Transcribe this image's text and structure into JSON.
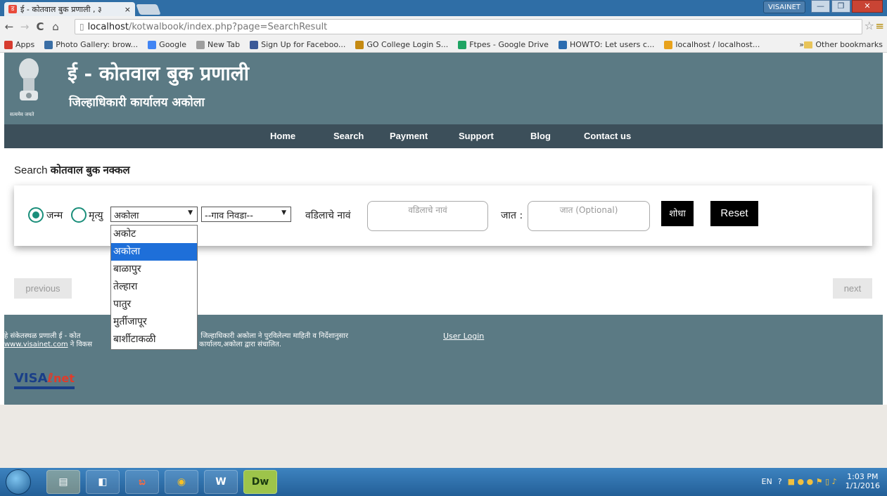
{
  "browser": {
    "tab_title": "ई - कोतवाल बुक प्रणाली , ३",
    "tab_close": "×",
    "url_host": "localhost",
    "url_path": "/kotwalbook/index.php?page=SearchResult",
    "account": "VISAINET",
    "win_min": "—",
    "win_max": "❐",
    "win_close": "✕"
  },
  "bookmarks": [
    {
      "label": "Apps",
      "color": "#d63b2f"
    },
    {
      "label": "Photo Gallery: brow...",
      "color": "#3a6ea5"
    },
    {
      "label": "Google",
      "color": "#4285f4"
    },
    {
      "label": "New Tab",
      "color": "#9e9e9e"
    },
    {
      "label": "Sign Up for Faceboo...",
      "color": "#3b5998"
    },
    {
      "label": "GO College Login S...",
      "color": "#c58a12"
    },
    {
      "label": "Ftpes - Google Drive",
      "color": "#1fa463"
    },
    {
      "label": "HOWTO: Let users c...",
      "color": "#2b6cb0"
    },
    {
      "label": "localhost / localhost...",
      "color": "#e8a21c"
    }
  ],
  "bookmarks_more": "»",
  "bookmarks_other": "Other bookmarks",
  "header": {
    "emblem_caption": "सत्यमेव जयते",
    "title": "ई - कोतवाल बुक प्रणाली",
    "subtitle": "जिल्हाधिकारी कार्यालय अकोला"
  },
  "nav": [
    "Home",
    "Search",
    "Payment",
    "Support",
    "Blog",
    "Contact us"
  ],
  "page_heading_prefix": "Search",
  "page_heading_main": "कोतवाल बुक नक्कल",
  "search": {
    "radio_birth": "जन्म",
    "radio_death": "मृत्यु",
    "taluka_selected": "अकोला",
    "village_selected": "--गाव निवडा--",
    "father_label": "वडिलाचे नावं",
    "father_placeholder": "वडिलाचे नावं",
    "caste_label": "जात :",
    "caste_placeholder": "जात (Optional)",
    "search_btn": "शोधा",
    "reset_btn": "Reset"
  },
  "taluka_options": [
    "अकोट",
    "अकोला",
    "बाळापुर",
    "तेल्हारा",
    "पातुर",
    "मुर्तीजापूर",
    "बार्शीटाकळी"
  ],
  "taluka_selected_index": 1,
  "pager": {
    "previous": "previous",
    "next": "next"
  },
  "footer": {
    "line1": "हे संकेतस्थळ प्रणाली ई - कोत",
    "line1b": "अंतर्गत :: जिल्हाधिकारी अकोला ने पुरविलेल्या माहिती व निर्देशानुसार",
    "line2": "www.visainet.com",
    "line2b": "ने विकस",
    "line2c": "हाधिकारी कार्यालय,अकोला द्वारा संचालित.",
    "user_login": "User Login",
    "logo_v": "VISA",
    "logo_net": "net"
  },
  "taskbar": {
    "lang": "EN",
    "time": "1:03 PM",
    "date": "1/1/2016",
    "apps": [
      "",
      "",
      "",
      "",
      "",
      "Dw"
    ]
  }
}
